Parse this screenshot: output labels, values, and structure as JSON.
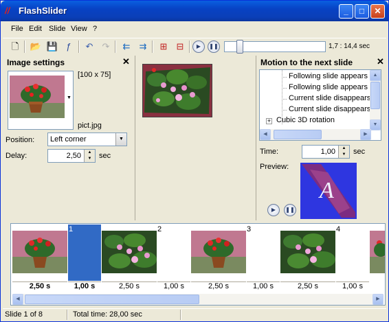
{
  "window": {
    "title": "FlashSlider",
    "app_icon": "flashslider-logo-icon"
  },
  "title_buttons": [
    "minimize-button",
    "maximize-button",
    "close-button"
  ],
  "menu": [
    "File",
    "Edit",
    "Slide",
    "View",
    "?"
  ],
  "toolbar": {
    "icons": [
      "new-icon",
      "open-icon",
      "save-icon",
      "flash-icon",
      "undo-icon",
      "redo-icon",
      "move-left-icon",
      "move-right-icon",
      "film-add-icon",
      "film-remove-icon",
      "play-icon",
      "pause-icon"
    ],
    "position_fraction": 0.12,
    "time_readout": "1,7 : 14,4 sec"
  },
  "image_settings": {
    "title": "Image settings",
    "dimensions": "[100 x 75]",
    "filename": "pict.jpg",
    "position_label": "Position:",
    "position_value": "Left corner",
    "delay_label": "Delay:",
    "delay_value": "2,50",
    "delay_unit": "sec"
  },
  "motion": {
    "title": "Motion to the next slide",
    "items": [
      "Following slide appears f",
      "Following slide appears f",
      "Current slide disappears",
      "Current slide disappears"
    ],
    "group": "Cubic 3D rotation",
    "time_label": "Time:",
    "time_value": "1,00",
    "time_unit": "sec",
    "preview_label": "Preview:",
    "preview_letter": "A"
  },
  "timeline": {
    "slides": [
      {
        "num": "1",
        "image": "red-flowers",
        "delay": "2,50 s",
        "transition": "1,00 s",
        "selected": true
      },
      {
        "num": "2",
        "image": "water-lilies",
        "delay": "2,50 s",
        "transition": "1,00 s",
        "selected": false
      },
      {
        "num": "3",
        "image": "red-flowers",
        "delay": "2,50 s",
        "transition": "1,00 s",
        "selected": false
      },
      {
        "num": "4",
        "image": "water-lilies",
        "delay": "2,50 s",
        "transition": "1,00 s",
        "selected": false
      }
    ]
  },
  "status": {
    "slide": "Slide 1 of 8",
    "total": "Total time: 28,00 sec"
  },
  "colors": {
    "titlebar": "#0a46d0",
    "selection": "#316ac5",
    "window_bg": "#ece9d8",
    "preview_bg": "#2e36e0"
  }
}
